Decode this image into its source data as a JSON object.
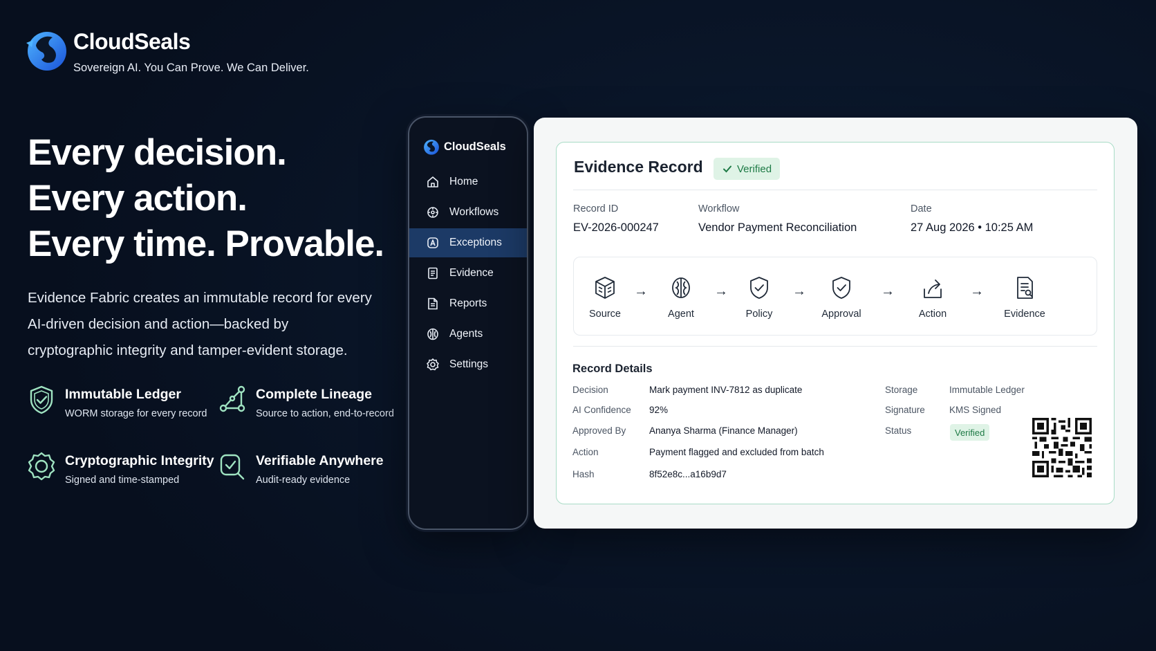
{
  "brand": {
    "name": "CloudSeals",
    "tagline": "Sovereign AI. You Can Prove. We Can Deliver."
  },
  "hero": {
    "headline": [
      "Every decision.",
      "Every action.",
      "Every time. Provable."
    ],
    "description": "Evidence Fabric creates an immutable record for every AI-driven decision and action—backed by cryptographic integrity and tamper-evident storage."
  },
  "features": [
    {
      "icon": "shield-check-icon",
      "title": "Immutable Ledger",
      "subtitle": "WORM storage for every record"
    },
    {
      "icon": "lineage-nodes-icon",
      "title": "Complete Lineage",
      "subtitle": "Source to action, end-to-record"
    },
    {
      "icon": "gear-check-icon",
      "title": "Cryptographic Integrity",
      "subtitle": "Signed and time-stamped"
    },
    {
      "icon": "magnify-check-icon",
      "title": "Verifiable Anywhere",
      "subtitle": "Audit-ready evidence"
    }
  ],
  "sidebar": {
    "brand": "CloudSeals",
    "items": [
      {
        "label": "Home",
        "icon": "home-icon",
        "active": false
      },
      {
        "label": "Workflows",
        "icon": "workflow-icon",
        "active": false
      },
      {
        "label": "Exceptions",
        "icon": "exception-icon",
        "active": true
      },
      {
        "label": "Evidence",
        "icon": "document-icon",
        "active": false
      },
      {
        "label": "Reports",
        "icon": "report-icon",
        "active": false
      },
      {
        "label": "Agents",
        "icon": "agent-brain-icon",
        "active": false
      },
      {
        "label": "Settings",
        "icon": "gear-icon",
        "active": false
      }
    ]
  },
  "record": {
    "title": "Evidence Record",
    "badge": "Verified",
    "meta": {
      "record_id_label": "Record ID",
      "record_id": "EV-2026-000247",
      "workflow_label": "Workflow",
      "workflow": "Vendor Payment Reconciliation",
      "date_label": "Date",
      "date": "27 Aug 2026 • 10:25 AM"
    },
    "flow": [
      {
        "label": "Source",
        "icon": "cube-stack-icon"
      },
      {
        "label": "Agent",
        "icon": "brain-icon"
      },
      {
        "label": "Policy",
        "icon": "shield-check-icon"
      },
      {
        "label": "Approval",
        "icon": "shield-check-icon"
      },
      {
        "label": "Action",
        "icon": "share-out-icon"
      },
      {
        "label": "Evidence",
        "icon": "document-search-icon"
      }
    ],
    "arrow": "→",
    "details_title": "Record Details",
    "details": [
      {
        "label": "Decision",
        "value": "Mark payment INV-7812 as duplicate"
      },
      {
        "label": "AI Confidence",
        "value": "92%"
      },
      {
        "label": "Approved By",
        "value": "Ananya Sharma (Finance Manager)"
      },
      {
        "label": "Action",
        "value": "Payment flagged and excluded from batch"
      },
      {
        "label": "Hash",
        "value": "8f52e8c...a16b9d7"
      }
    ],
    "side": [
      {
        "label": "Storage",
        "value": "Immutable Ledger"
      },
      {
        "label": "Signature",
        "value": "KMS Signed"
      },
      {
        "label": "Status",
        "value": "Verified"
      }
    ]
  },
  "colors": {
    "accent_green": "#1d7a45",
    "active_nav": "#1c3a66",
    "feature_icon": "#9fe3c1"
  }
}
